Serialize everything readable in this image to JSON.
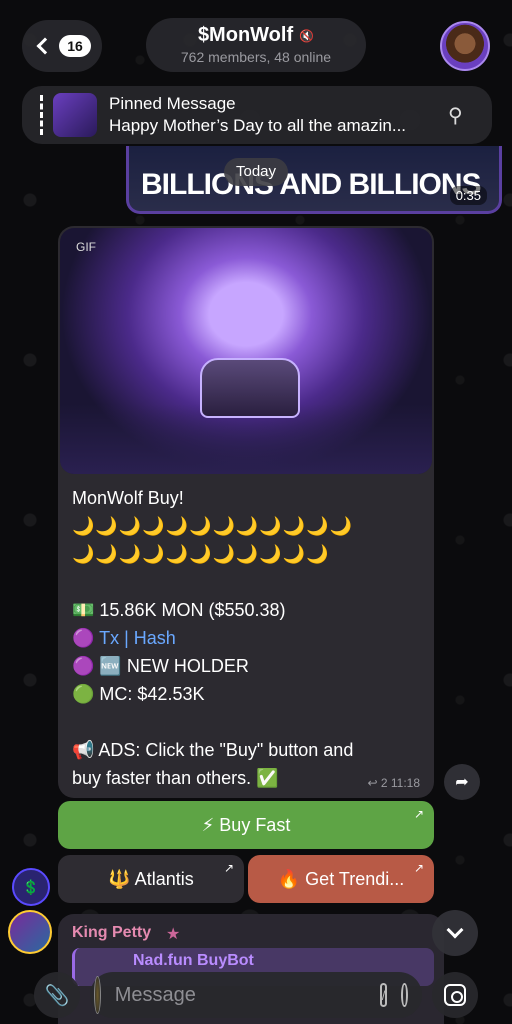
{
  "header": {
    "back_count": "16",
    "title": "$MonWolf",
    "subtitle": "762 members, 48 online"
  },
  "pinned": {
    "title": "Pinned Message",
    "body": "Happy Mother’s Day to all the amazin..."
  },
  "video": {
    "headline": "BILLIONS AND BILLIONS",
    "duration": "0:35"
  },
  "date_chip": "Today",
  "message": {
    "gif_label": "GIF",
    "title": "MonWolf Buy!",
    "moons_row1": "🌙🌙🌙🌙🌙🌙🌙🌙🌙🌙🌙🌙",
    "moons_row2": "🌙🌙🌙🌙🌙🌙🌙🌙🌙🌙🌙",
    "amount": "💵 15.86K MON ($550.38)",
    "tx_prefix": "🟣 ",
    "tx_link": "Tx | Hash",
    "holder": "🟣 🆕 NEW HOLDER",
    "mc": "🟢 MC: $42.53K",
    "ads": "📢 ADS: Click the \"Buy\" button and",
    "ads2": "buy faster than others. ✅",
    "replies": "↩ 2",
    "time": "11:18"
  },
  "buttons": {
    "buy_fast": "⚡ Buy Fast",
    "atlantis": "🔱 Atlantis",
    "trending": "🔥 Get Trendi..."
  },
  "next_message": {
    "sender": "King Petty",
    "reply_label": "Nad.fun BuyBot"
  },
  "composer": {
    "placeholder": "Message"
  }
}
